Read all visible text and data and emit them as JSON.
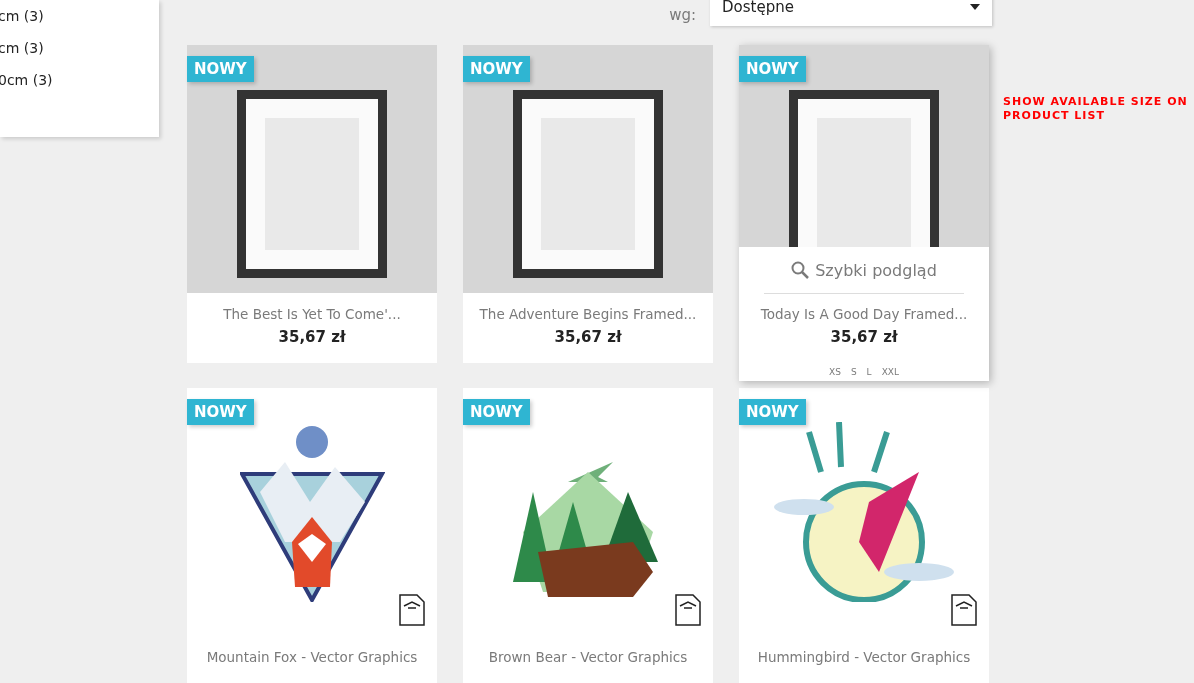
{
  "filters": [
    "cm (3)",
    "cm (3)",
    "0cm (3)"
  ],
  "sort": {
    "label": "wg:",
    "value": "Dostępne"
  },
  "note": "SHOW AVAILABLE SIZE ON PRODUCT LIST",
  "products": [
    {
      "kind": "poster",
      "badge": "NOWY",
      "name": "The Best Is Yet To Come'...",
      "price": "35,67 zł",
      "hovered": false
    },
    {
      "kind": "poster",
      "badge": "NOWY",
      "name": "The Adventure Begins Framed...",
      "price": "35,67 zł",
      "hovered": false
    },
    {
      "kind": "poster",
      "badge": "NOWY",
      "name": "Today Is A Good Day Framed...",
      "price": "35,67 zł",
      "hovered": true,
      "quick_view": "Szybki podgląd",
      "sizes": [
        "XS",
        "S",
        "L",
        "XXL"
      ]
    },
    {
      "kind": "fox",
      "badge": "NOWY",
      "name": "Mountain Fox - Vector Graphics",
      "hovered": false
    },
    {
      "kind": "bear",
      "badge": "NOWY",
      "name": "Brown Bear - Vector Graphics",
      "hovered": false
    },
    {
      "kind": "bird",
      "badge": "NOWY",
      "name": "Hummingbird - Vector Graphics",
      "hovered": false
    }
  ]
}
